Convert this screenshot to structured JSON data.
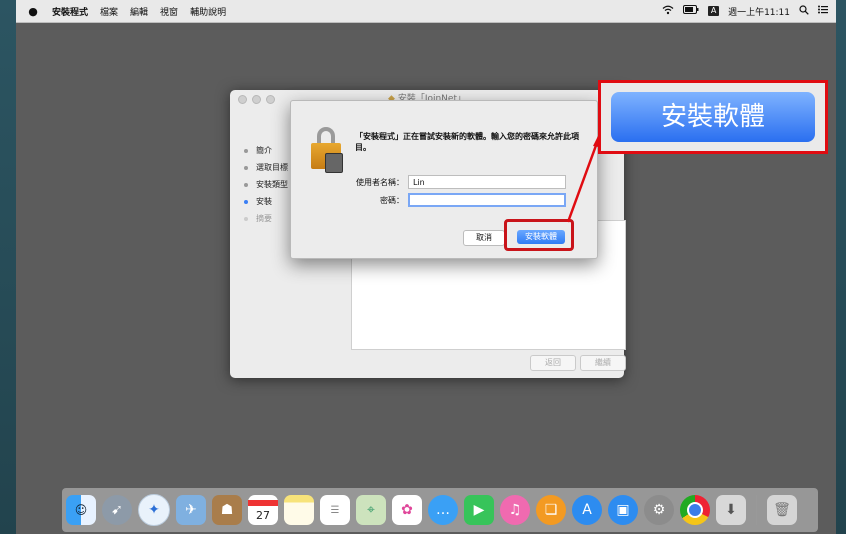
{
  "menubar": {
    "apple": "",
    "items": [
      "安裝程式",
      "檔案",
      "編輯",
      "視窗",
      "輔助說明"
    ],
    "status_badge": "A",
    "clock": "週一上午11:11"
  },
  "installer": {
    "title": "安裝「JoinNet」",
    "steps": [
      "簡介",
      "選取目標",
      "安裝類型",
      "安裝",
      "摘要"
    ],
    "back_label": "返回",
    "continue_label": "繼續"
  },
  "auth_dialog": {
    "message": "「安裝程式」正在嘗試安裝新的軟體。輸入您的密碼來允許此項目。",
    "username_label": "使用者名稱：",
    "username_value": "Lin",
    "password_label": "密碼：",
    "password_value": "",
    "cancel_label": "取消",
    "install_label": "安裝軟體"
  },
  "callout": {
    "label": "安裝軟體",
    "highlight_color": "#e00c12"
  },
  "dock": {
    "calendar_day": "27",
    "icons": [
      "finder-icon",
      "launchpad-icon",
      "safari-icon",
      "mail-icon",
      "contacts-icon",
      "calendar-icon",
      "notes-icon",
      "reminders-icon",
      "maps-icon",
      "photos-icon",
      "messages-icon",
      "facetime-icon",
      "itunes-icon",
      "ibooks-icon",
      "app-store-icon",
      "zoom-icon",
      "system-preferences-icon",
      "chrome-icon",
      "installer-icon",
      "trash-icon"
    ]
  }
}
